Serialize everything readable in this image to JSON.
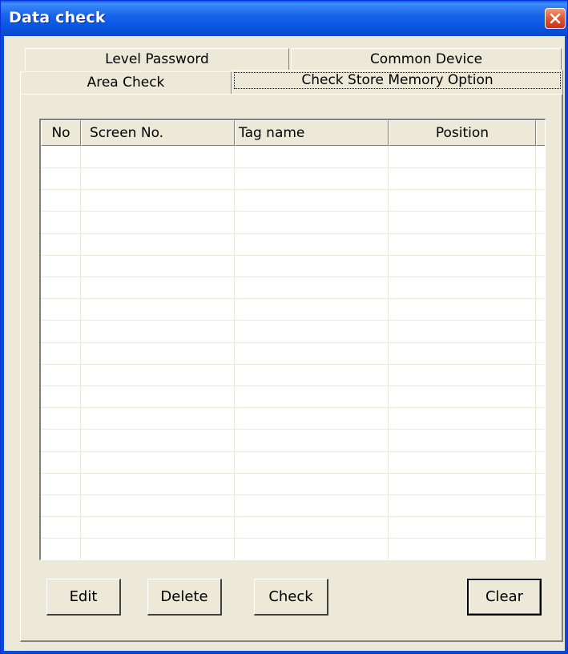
{
  "window": {
    "title": "Data check"
  },
  "icons": {
    "close": "close-icon"
  },
  "colors": {
    "titlebar": "#0a5ee6",
    "close_button": "#e35a35",
    "face": "#ece9d8"
  },
  "tabs": {
    "row1": [
      {
        "label": "Level Password"
      },
      {
        "label": "Common Device"
      }
    ],
    "row2": [
      {
        "label": "Area Check"
      },
      {
        "label": "Check Store Memory Option",
        "active": true
      }
    ]
  },
  "table": {
    "columns": [
      "No",
      "Screen No.",
      "Tag name",
      "Position"
    ],
    "rows": []
  },
  "buttons": {
    "edit": "Edit",
    "delete": "Delete",
    "check": "Check",
    "clear": "Clear"
  }
}
